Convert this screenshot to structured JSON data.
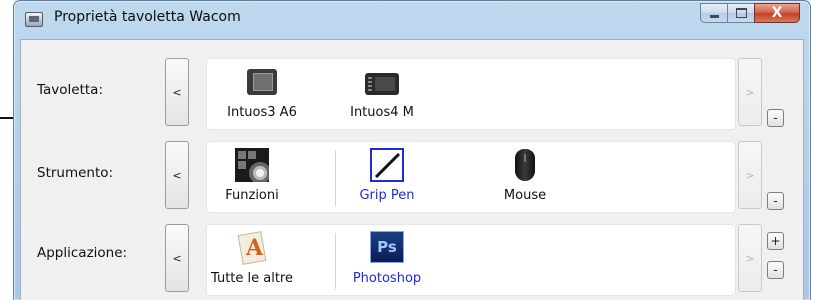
{
  "window": {
    "title": "Proprietà tavoletta Wacom",
    "close_glyph": "X"
  },
  "rows": [
    {
      "label": "Tavoletta:",
      "prev": "<",
      "next": ">",
      "items": [
        {
          "label": "Intuos3 A6",
          "icon": "intuos3-tablet-icon",
          "selected": false
        },
        {
          "label": "Intuos4 M",
          "icon": "intuos4-tablet-icon",
          "selected": false
        }
      ],
      "buttons": [
        "-"
      ]
    },
    {
      "label": "Strumento:",
      "prev": "<",
      "next": ">",
      "items": [
        {
          "label": "Funzioni",
          "icon": "functions-icon",
          "selected": false
        },
        {
          "label": "Grip Pen",
          "icon": "grip-pen-icon",
          "selected": true
        },
        {
          "label": "Mouse",
          "icon": "mouse-icon",
          "selected": false
        }
      ],
      "buttons": [
        "-"
      ]
    },
    {
      "label": "Applicazione:",
      "prev": "<",
      "next": ">",
      "items": [
        {
          "label": "Tutte le altre",
          "icon": "all-other-apps-icon",
          "selected": false
        },
        {
          "label": "Photoshop",
          "icon": "photoshop-icon",
          "selected": true,
          "icon_text": "Ps"
        }
      ],
      "buttons": [
        "+",
        "-"
      ]
    }
  ],
  "colors": {
    "selected_text": "#1d2bd6",
    "titlebar": "#b5cfe9",
    "close_button": "#c94a2c"
  }
}
